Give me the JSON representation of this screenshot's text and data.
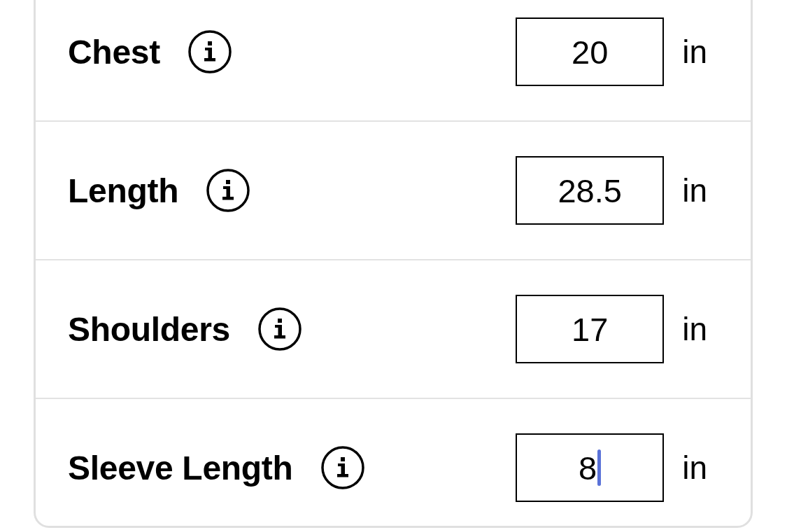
{
  "measurements": [
    {
      "label": "Chest",
      "value": "20",
      "unit": "in",
      "focused": false
    },
    {
      "label": "Length",
      "value": "28.5",
      "unit": "in",
      "focused": false
    },
    {
      "label": "Shoulders",
      "value": "17",
      "unit": "in",
      "focused": false
    },
    {
      "label": "Sleeve Length",
      "value": "8",
      "unit": "in",
      "focused": true
    }
  ]
}
